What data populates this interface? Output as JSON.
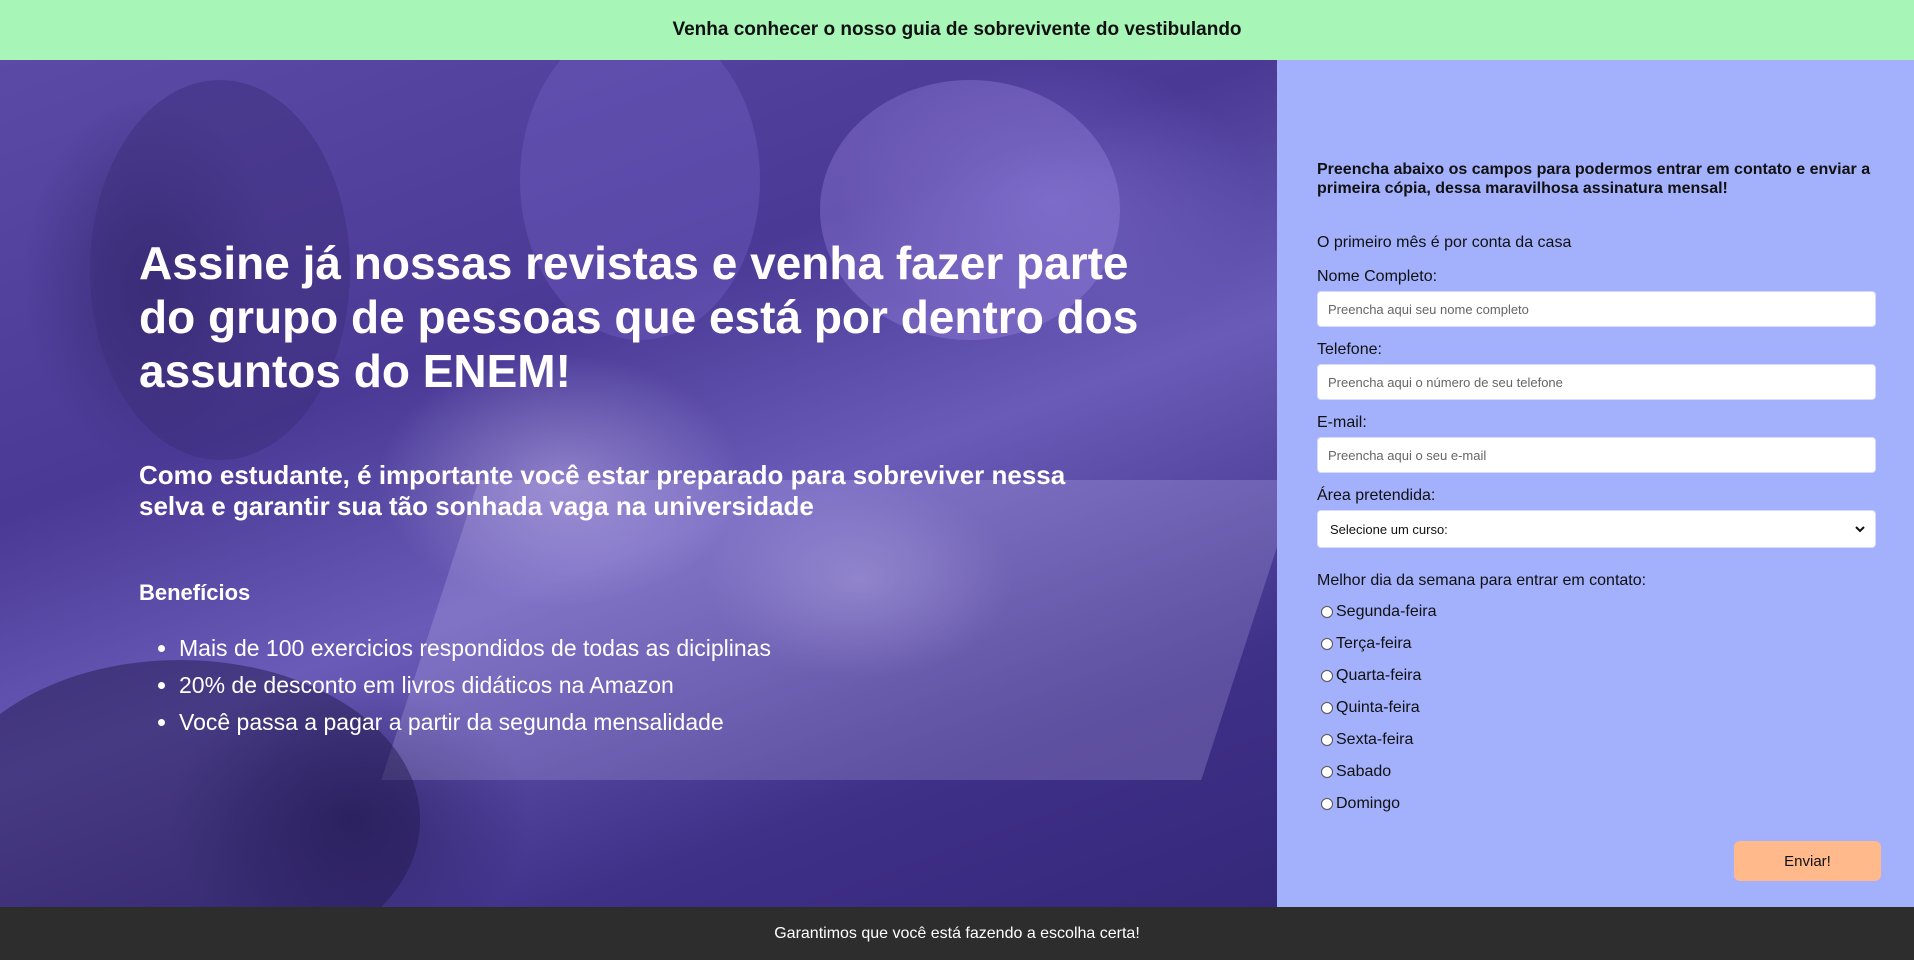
{
  "top_banner": {
    "text": "Venha conhecer o nosso guia de sobrevivente do vestibulando"
  },
  "hero": {
    "title": "Assine já nossas revistas e venha fazer parte do grupo de pessoas que está por dentro dos assuntos do ENEM!",
    "subtitle": "Como estudante, é importante você estar preparado para sobreviver nessa selva e garantir sua tão sonhada vaga na universidade",
    "benefits_title": "Benefícios",
    "benefits": [
      "Mais de 100 exercicios respondidos de todas as diciplinas",
      "20% de desconto em livros didáticos na Amazon",
      "Você passa a pagar a partir da segunda mensalidade"
    ]
  },
  "form": {
    "intro": "Preencha abaixo os campos para podermos entrar em contato e enviar a primeira cópia, dessa maravilhosa assinatura mensal!",
    "note": "O primeiro mês é por conta da casa",
    "name_label": "Nome Completo:",
    "name_placeholder": "Preencha aqui seu nome completo",
    "phone_label": "Telefone:",
    "phone_placeholder": "Preencha aqui o número de seu telefone",
    "email_label": "E-mail:",
    "email_placeholder": "Preencha aqui o seu e-mail",
    "area_label": "Área pretendida:",
    "area_selected": "Selecione um curso:",
    "day_label": "Melhor dia da semana para entrar em contato:",
    "days": [
      "Segunda-feira",
      "Terça-feira",
      "Quarta-feira",
      "Quinta-feira",
      "Sexta-feira",
      "Sabado",
      "Domingo"
    ],
    "submit_label": "Enviar!"
  },
  "footer": {
    "text": "Garantimos que você está fazendo a escolha certa!"
  },
  "colors": {
    "banner": "#a8f5b8",
    "hero_overlay": "#4a3a96",
    "form_bg": "#a3b0fc",
    "submit": "#ffb98a",
    "footer": "#2d2d2d"
  },
  "icons": {
    "select_arrow": "chevron-down-icon"
  }
}
